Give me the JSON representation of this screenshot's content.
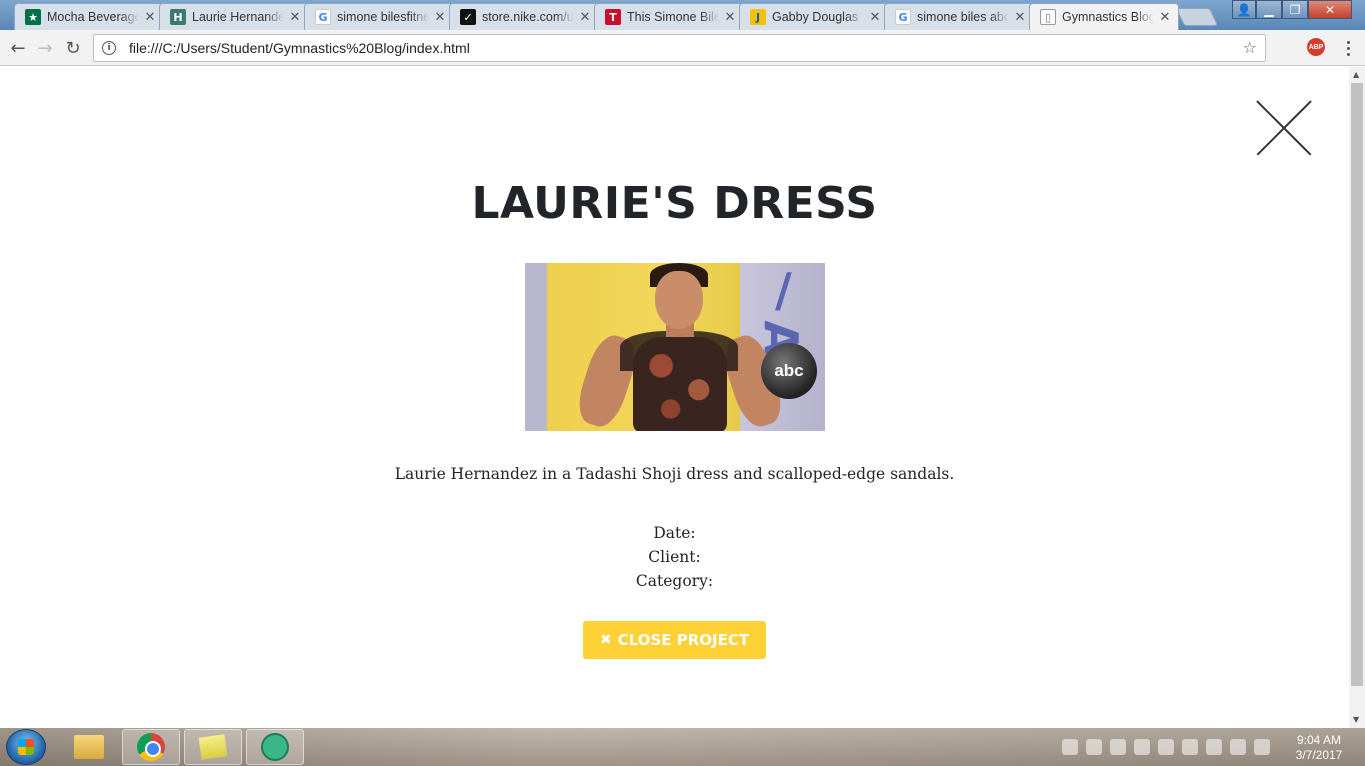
{
  "browser": {
    "tabs": [
      {
        "title": "Mocha Beverages",
        "favicon": "starbucks-icon",
        "color": "#00704a"
      },
      {
        "title": "Laurie Hernandez",
        "favicon": "h-icon",
        "color": "#3c7a6e"
      },
      {
        "title": "simone bilesfitness",
        "favicon": "google-icon",
        "color": "#4285f4"
      },
      {
        "title": "store.nike.com/us",
        "favicon": "nike-icon",
        "color": "#111111"
      },
      {
        "title": "This Simone Biles",
        "favicon": "time-icon",
        "color": "#c8102e"
      },
      {
        "title": "Gabby Douglas",
        "favicon": "j-icon",
        "color": "#f4c20d"
      },
      {
        "title": "simone biles about",
        "favicon": "google-icon",
        "color": "#4285f4"
      },
      {
        "title": "Gymnastics Blog",
        "favicon": "page-icon",
        "color": "#777777"
      }
    ],
    "active_tab_index": 7,
    "url": "file:///C:/Users/Student/Gymnastics%20Blog/index.html",
    "abp_label": "ABP"
  },
  "page": {
    "title": "LAURIE'S DRESS",
    "caption": "Laurie Hernandez in a Tadashi Shoji dress and scalloped-edge sandals.",
    "meta": {
      "date_label": "Date:",
      "client_label": "Client:",
      "category_label": "Category:"
    },
    "close_button_label": "CLOSE PROJECT",
    "close_button_icon": "times-icon",
    "accent_color": "#fed136",
    "photo_logo": "abc"
  },
  "taskbar": {
    "time": "9:04 AM",
    "date": "3/7/2017",
    "pinned": [
      "windows-explorer",
      "google-chrome",
      "sticky-notes",
      "atom-editor"
    ]
  }
}
